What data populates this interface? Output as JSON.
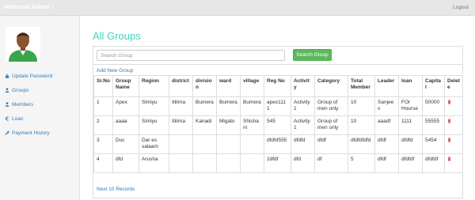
{
  "header": {
    "brand": "Welcome Admin !",
    "logout": "Logout"
  },
  "sidebar": {
    "items": [
      {
        "label": "Update Password",
        "icon": "lock-icon"
      },
      {
        "label": "Groups",
        "icon": "user-icon"
      },
      {
        "label": "Members",
        "icon": "user-icon"
      },
      {
        "label": "Loan",
        "icon": "euro-icon"
      },
      {
        "label": "Payment History",
        "icon": "wrench-icon"
      }
    ]
  },
  "main": {
    "title": "All Groups",
    "search": {
      "placeholder": "Search Group",
      "value": "",
      "button": "Search Group"
    },
    "add_link": "Add New Group",
    "next_link": "Next 10 Records",
    "columns": [
      "Sr.No",
      "Group Name",
      "Region",
      "district",
      "division",
      "ward",
      "village",
      "Reg No",
      "Activity",
      "Category",
      "Total Member",
      "Leader",
      "loan",
      "Capital",
      "Delete"
    ],
    "rows": [
      [
        "1",
        "Apex",
        "Simiyu",
        "Itilima",
        "Bumera",
        "Bumera",
        "Bumera",
        "apex1111",
        "Activity 1",
        "Group of men only",
        "10",
        "Sanjeev",
        "FOr Hourse",
        "50000",
        ""
      ],
      [
        "2",
        "aaaa",
        "Simiyu",
        "Itilima",
        "Kanadi",
        "Migato",
        "Shishani",
        "545",
        "Activity 1",
        "Group of men only",
        "10",
        "aaadf",
        "1111",
        "55555",
        ""
      ],
      [
        "3",
        "Duc",
        "Dar es salaam",
        "",
        "",
        "",
        "",
        "dfdfd555",
        "dfdfd",
        "dfdf",
        "dfdfdfdfd",
        "dfdf",
        "dfdfd",
        "5454",
        ""
      ],
      [
        "4",
        "dfd",
        "Arusha",
        "",
        "",
        "",
        "",
        "2dfdf",
        "dfd",
        "df",
        "5",
        "dfdf",
        "dfdfdf",
        "dfdfdf",
        ""
      ]
    ]
  },
  "colors": {
    "title": "#3fd3c2",
    "button": "#5cb85c",
    "link": "#337ab7",
    "delete": "#d9534f"
  }
}
